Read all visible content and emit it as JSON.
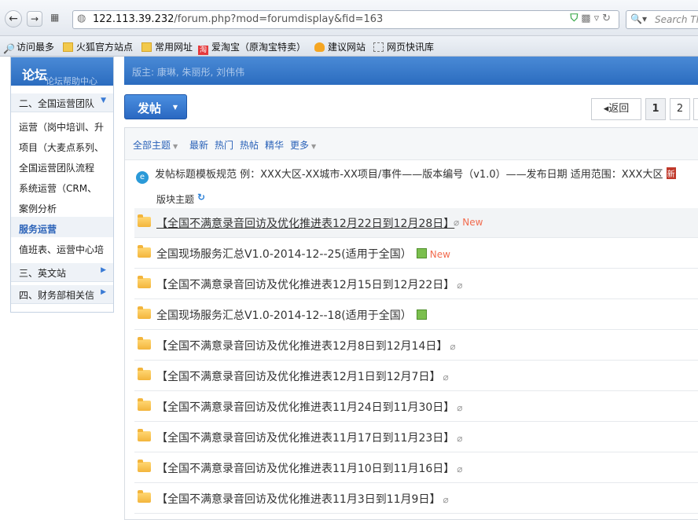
{
  "browser": {
    "url_host": "122.113.39.232",
    "url_path": "/forum.php?mod=forumdisplay&fid=163",
    "search_placeholder": "Search Th"
  },
  "bookmarks": [
    {
      "label": "访问最多",
      "icon": "magnifier-icon"
    },
    {
      "label": "火狐官方站点",
      "icon": "folder-icon"
    },
    {
      "label": "常用网址",
      "icon": "folder-icon"
    },
    {
      "label": "爱淘宝（原淘宝特卖）",
      "icon": "taobao-icon"
    },
    {
      "label": "建议网站",
      "icon": "bulb-icon"
    },
    {
      "label": "网页快讯库",
      "icon": "feed-icon"
    }
  ],
  "sidebar": {
    "title": "论坛",
    "overlap_text": "论坛帮助中心",
    "groups": [
      {
        "label": "二、全国运营团队"
      },
      {
        "label": "三、英文站"
      },
      {
        "label": "四、财务部相关信"
      }
    ],
    "items": [
      {
        "label": "运营（岗中培训、升"
      },
      {
        "label": "项目（大麦点系列、"
      },
      {
        "label": "全国运营团队流程"
      },
      {
        "label": "系统运营（CRM、"
      },
      {
        "label": "案例分析"
      },
      {
        "label": "服务运营"
      },
      {
        "label": "值班表、运营中心培"
      }
    ]
  },
  "banner": {
    "moderators": "版主: 康琳, 朱丽彤, 刘伟伟"
  },
  "toolbar": {
    "post_label": "发帖"
  },
  "pager": {
    "back_label": "返回",
    "pages": [
      "1",
      "2"
    ]
  },
  "filters": [
    {
      "label": "全部主题",
      "dropdown": true
    },
    {
      "label": "最新",
      "dropdown": false
    },
    {
      "label": "热门",
      "dropdown": false
    },
    {
      "label": "热帖",
      "dropdown": false
    },
    {
      "label": "精华",
      "dropdown": false
    },
    {
      "label": "更多",
      "dropdown": true
    }
  ],
  "announcement": {
    "text": "发帖标题模板规范 例：XXX大区-XX城市-XX项目/事件——版本编号（v1.0）——发布日期 适用范围：XXX大区",
    "tag": "新"
  },
  "list_header": {
    "label": "版块主题"
  },
  "threads": [
    {
      "title": "【全国不满意录音回访及优化推进表12月22日到12月28日】",
      "attach": "clip",
      "new": "New"
    },
    {
      "title": "全国现场服务汇总V1.0-2014-12--25(适用于全国）",
      "attach": "image",
      "new": "New"
    },
    {
      "title": "【全国不满意录音回访及优化推进表12月15日到12月22日】",
      "attach": "clip",
      "new": ""
    },
    {
      "title": "全国现场服务汇总V1.0-2014-12--18(适用于全国）",
      "attach": "image",
      "new": ""
    },
    {
      "title": "【全国不满意录音回访及优化推进表12月8日到12月14日】",
      "attach": "clip",
      "new": ""
    },
    {
      "title": "【全国不满意录音回访及优化推进表12月1日到12月7日】",
      "attach": "clip",
      "new": ""
    },
    {
      "title": "【全国不满意录音回访及优化推进表11月24日到11月30日】",
      "attach": "clip",
      "new": ""
    },
    {
      "title": "【全国不满意录音回访及优化推进表11月17日到11月23日】",
      "attach": "clip",
      "new": ""
    },
    {
      "title": "【全国不满意录音回访及优化推进表11月10日到11月16日】",
      "attach": "clip",
      "new": ""
    },
    {
      "title": "【全国不满意录音回访及优化推进表11月3日到11月9日】",
      "attach": "clip",
      "new": ""
    }
  ]
}
